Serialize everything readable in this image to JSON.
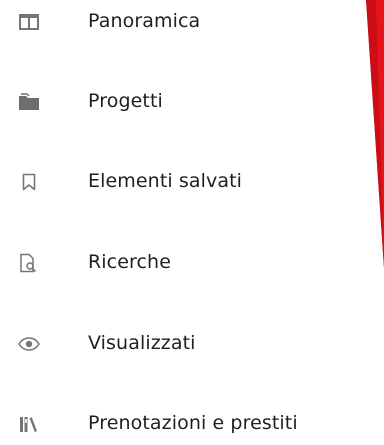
{
  "menu": {
    "items": [
      {
        "label": "Panoramica",
        "icon": "panel-layout-icon"
      },
      {
        "label": "Progetti",
        "icon": "folder-icon"
      },
      {
        "label": "Elementi salvati",
        "icon": "bookmark-icon"
      },
      {
        "label": "Ricerche",
        "icon": "document-search-icon"
      },
      {
        "label": "Visualizzati",
        "icon": "eye-icon"
      },
      {
        "label": "Prenotazioni e prestiti",
        "icon": "library-books-icon"
      }
    ]
  },
  "colors": {
    "text": "#1f1f1f",
    "icon": "#757575",
    "accent_red": "#e8131a"
  }
}
